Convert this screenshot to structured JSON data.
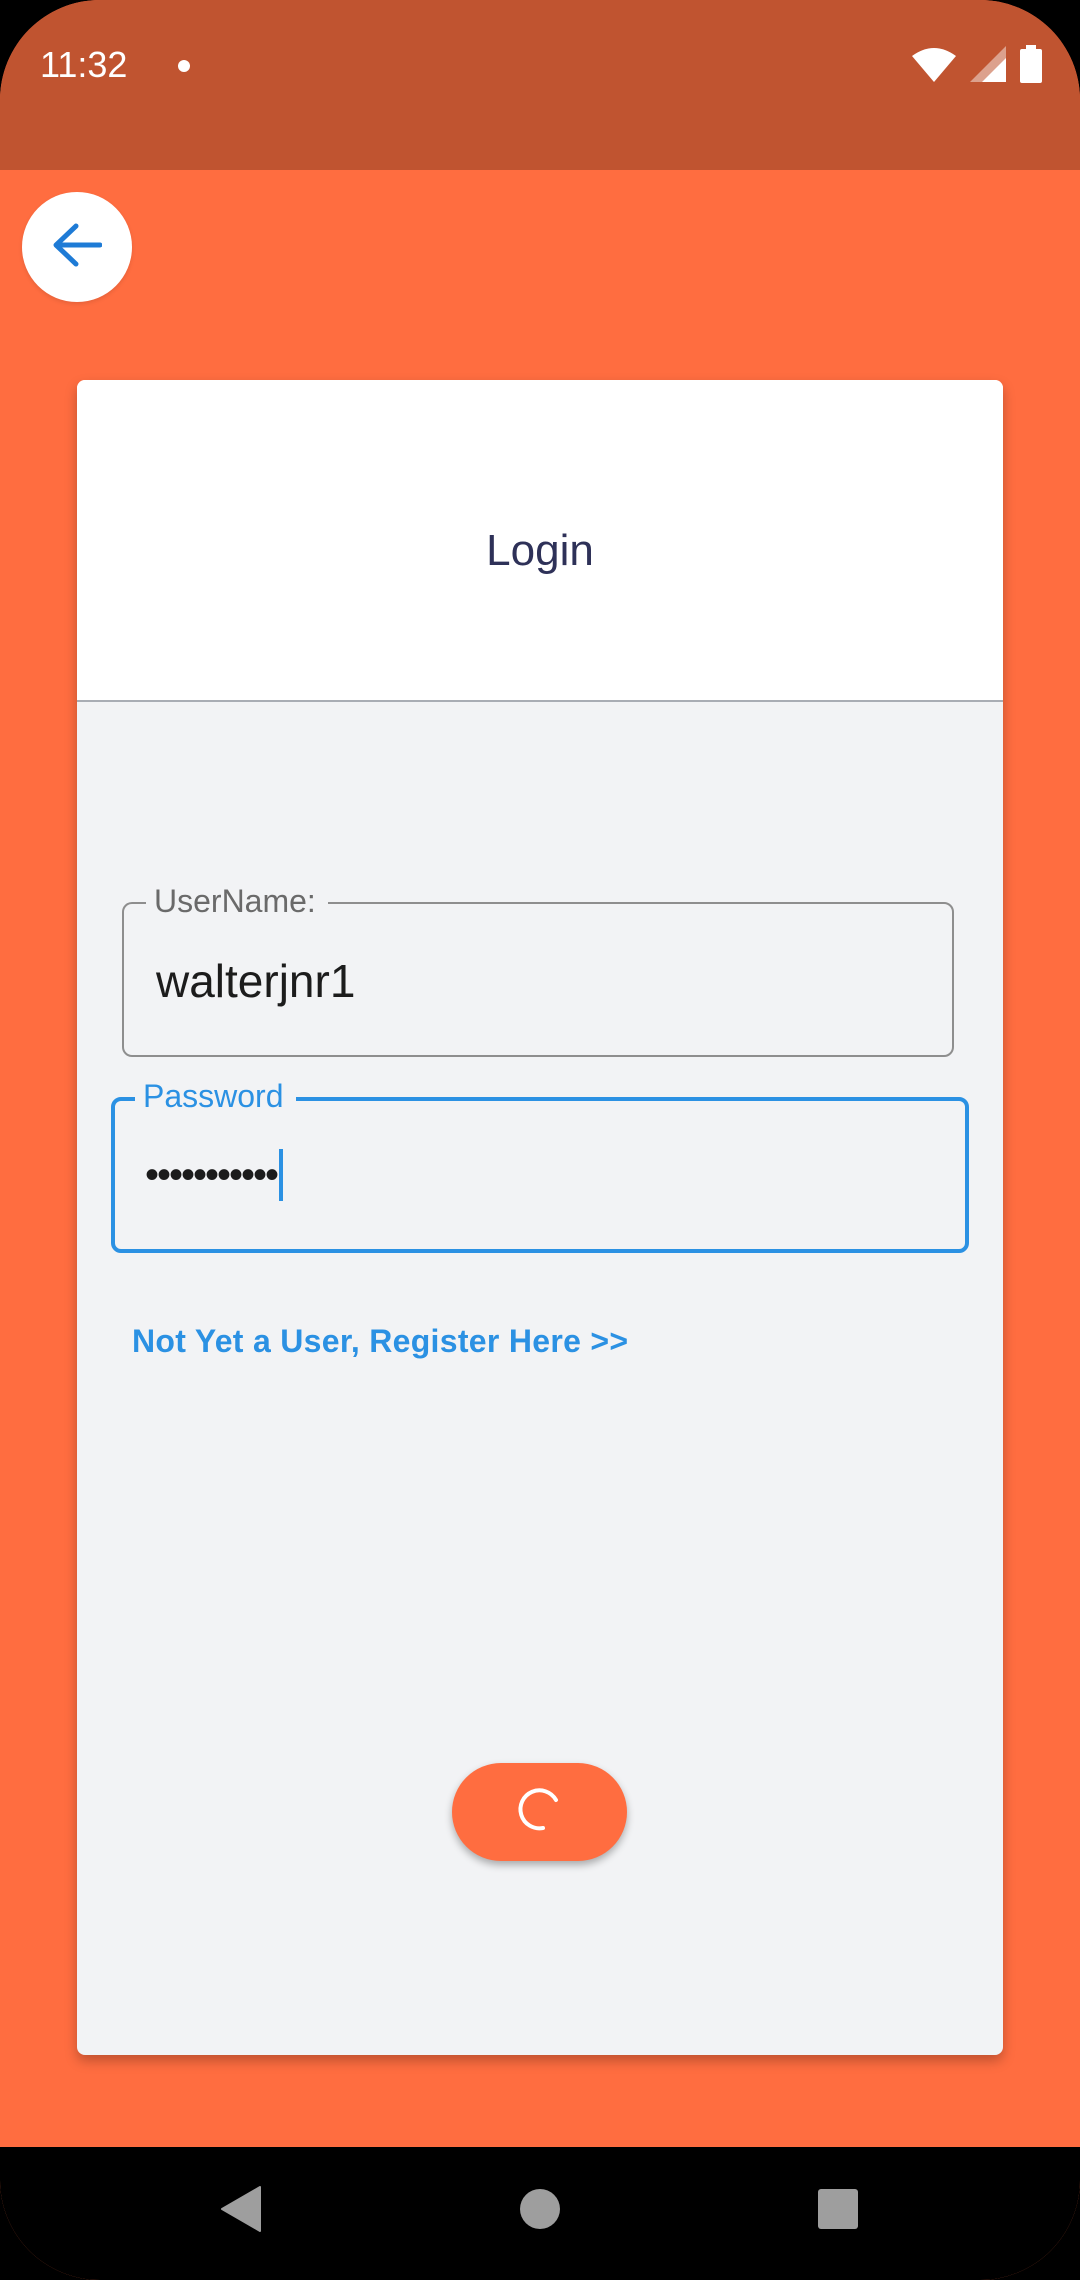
{
  "status_bar": {
    "time": "11:32",
    "icons": [
      "notification-dot-icon",
      "wifi-icon",
      "cell-signal-icon",
      "battery-icon"
    ]
  },
  "header": {
    "back_icon": "arrow-left-icon"
  },
  "card": {
    "title": "Login"
  },
  "form": {
    "username": {
      "label": "UserName:",
      "value": "walterjnr1"
    },
    "password": {
      "label": "Password",
      "value": "•••••••••••"
    },
    "register_link": "Not Yet a User, Register Here >>",
    "submit_state": "loading"
  },
  "nav": {
    "icons": [
      "back-triangle-icon",
      "home-circle-icon",
      "recents-square-icon"
    ]
  },
  "colors": {
    "background": "#FF6D40",
    "status_bar": "#C05430",
    "accent": "#2B91E3",
    "card_body": "#F2F3F5",
    "title_text": "#2E3158"
  }
}
